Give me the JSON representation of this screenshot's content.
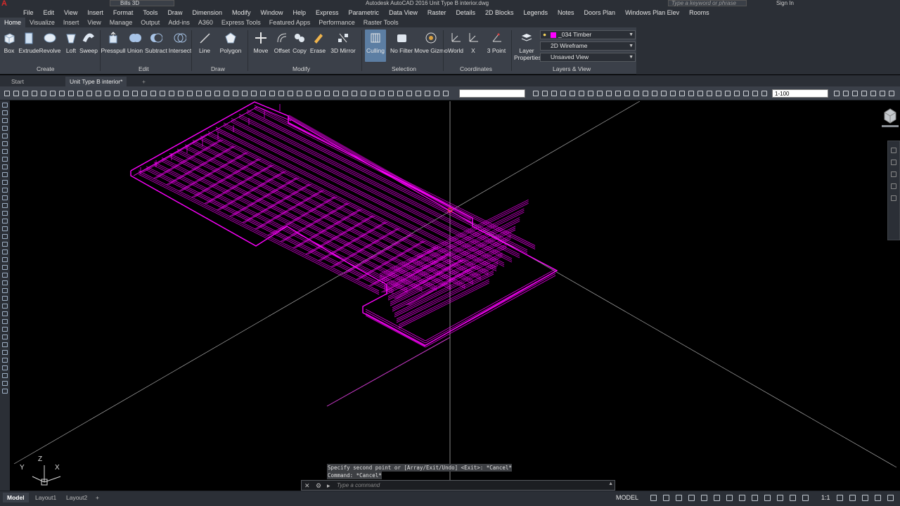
{
  "titlebar": {
    "workspace": "Bills 3D",
    "title": "Autodesk AutoCAD 2016    Unit Type B interior.dwg",
    "search_placeholder": "Type a keyword or phrase",
    "signin": "Sign In"
  },
  "menu": [
    "File",
    "Edit",
    "View",
    "Insert",
    "Format",
    "Tools",
    "Draw",
    "Dimension",
    "Modify",
    "Window",
    "Help",
    "Express",
    "Parametric",
    "Data View",
    "Raster",
    "Details",
    "2D Blocks",
    "Legends",
    "Notes",
    "Doors Plan",
    "Windows Plan Elev",
    "Rooms"
  ],
  "ribbon_tabs": [
    "Home",
    "Visualize",
    "Insert",
    "View",
    "Manage",
    "Output",
    "Add-ins",
    "A360",
    "Express Tools",
    "Featured Apps",
    "Performance",
    "Raster Tools"
  ],
  "ribbon": {
    "create": {
      "title": "Create",
      "buttons": [
        "Box",
        "Extrude",
        "Revolve",
        "Loft",
        "Sweep"
      ]
    },
    "edit": {
      "title": "Edit",
      "buttons": [
        "Presspull",
        "Union",
        "Subtract",
        "Intersect"
      ]
    },
    "draw": {
      "title": "Draw",
      "buttons": [
        "Line",
        "Polygon"
      ]
    },
    "modify": {
      "title": "Modify",
      "buttons": [
        "Move",
        "Offset",
        "Copy",
        "Erase",
        "3D Mirror"
      ]
    },
    "selection": {
      "title": "Selection",
      "buttons": [
        "Culling",
        "No Filter",
        "Move Gizmo"
      ]
    },
    "coordinates": {
      "title": "Coordinates",
      "buttons": [
        "World",
        "X",
        "3 Point"
      ]
    },
    "layers": {
      "title": "Layers & View",
      "button": "Layer Properties",
      "current_layer": "_034 Timber",
      "visual_style": "2D Wireframe",
      "view": "Unsaved View"
    }
  },
  "doc_tabs": [
    "Start",
    "Unit Type B interior*"
  ],
  "toolbar": {
    "scale": "1-100"
  },
  "command": {
    "history": [
      "Specify second point or [Array/Exit/Undo] <Exit>: *Cancel*",
      "Command: *Cancel*"
    ],
    "placeholder": "Type a command"
  },
  "ucs": {
    "x": "X",
    "y": "Y",
    "z": "Z"
  },
  "status": {
    "layout_tabs": [
      "Model",
      "Layout1",
      "Layout2"
    ],
    "mode": "MODEL",
    "scale": "1:1"
  },
  "colors": {
    "drawing": "#ff00ff",
    "ui_dark": "#2b2f36",
    "ui_panel": "#3b4049",
    "selected": "#5c7ea3"
  }
}
